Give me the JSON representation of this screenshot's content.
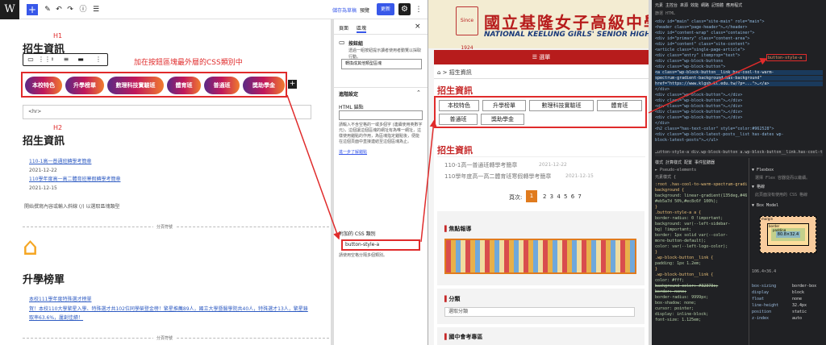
{
  "editor": {
    "logo": "W",
    "toolbar": {
      "add": "+",
      "pen": "✎",
      "undo": "↶",
      "redo": "↷",
      "info": "ⓘ",
      "list": "☰"
    },
    "save_draft": "儲存為草稿",
    "preview": "預覽",
    "update": "更新",
    "settings": "⚙",
    "more": "⋮",
    "annotation_h1": "H1",
    "annotation_h2": "H2",
    "annotation_note": "加在按鈕區塊最外層的CSS類別中",
    "title": "招生資訊",
    "buttons": [
      "本校特色",
      "升學榜單",
      "數理科技實驗班",
      "體育班",
      "普通班",
      "獎助學金"
    ],
    "hr_tag": "<hr>",
    "h2_title": "招生資訊",
    "posts": [
      {
        "title": "110-1高一普通班轉學考簡章",
        "date": "2021-12-22"
      },
      {
        "title": "110學年度高一高二體育班寒假轉學考簡章",
        "date": "2021-12-15"
      }
    ],
    "placeholder": "開始撰寫內容或輸入斜線 (/) 以選取區塊類型",
    "separator": "分頁符號",
    "house_icon": "⌂",
    "section2_title": "升學榜單",
    "section2_link": "本校111學年度特殊選才榜單",
    "section2_text": "賀！本校110大學繁星入學、特殊選才共102位同學榮登金榜！繁星推薦89人，國立大學暨醫學院共40人，特殊選才13人，繁星錄取率63.6%，屢創佳績！",
    "sidebar": {
      "tab_page": "頁面",
      "tab_block": "區塊",
      "close": "×",
      "block_name": "按鈕組",
      "block_desc": "透過一組按鈕提示讀者使用者動覽以採取行動。",
      "transform": "轉換成其他類型區塊",
      "advanced": "進階設定",
      "html_anchor": "HTML 錨點",
      "anchor_desc": "請輸入不含空格的一或多個字 (連續使用英數字元)，這個讓這個區塊的網址有為唯一網址，這樣使用錨點的作用，為區塊指定錨點後，便能在這個頁面中直接連結至這個區塊為止。",
      "anchor_link": "進一步了解錨點",
      "css_label": "附加的 CSS 類別",
      "css_value": "button-style-a",
      "css_desc": "請使用空格分隔多個類別。"
    }
  },
  "site": {
    "school_zh": "國立基隆女子高級中學",
    "school_en": "NATIONAL KEELUNG GIRLS' SENIOR HIGH SCHOOL",
    "since": "Since 1924",
    "menu": "☰ 選單",
    "breadcrumb": "⌂ > 招生資訊",
    "title": "招生資訊",
    "buttons": [
      "本校特色",
      "升學榜單",
      "數理科技實驗班",
      "體育班",
      "普通班",
      "獎助學金"
    ],
    "section_title": "招生資訊",
    "posts": [
      {
        "title": "110-1高一普通班轉學考簡章",
        "date": "2021-12-22"
      },
      {
        "title": "110學年度高一高二體育班寒假轉學考簡章",
        "date": "2021-12-15"
      }
    ],
    "page_label": "頁次:",
    "page_current": "1",
    "page_rest": "2 3 4 5 6 7",
    "focus": "焦點報導",
    "category": "分類",
    "category_select": "選取分類",
    "junior": "國中會考專區"
  },
  "devtools": {
    "tabs": "元素  主控台  來源  效能  網路  記憶體  應用程式",
    "filter": "篩選 HTML",
    "lines": [
      "<div id=\"main\" class=\"site-main\" role=\"main\">",
      " <header class=\"page-header\">…</header>",
      " <div id=\"content-wrap\" class=\"container\">",
      "  <div id=\"primary\" class=\"content-area\">",
      "   <div id=\"content\" class=\"site-content\">",
      "    <article class=\"single-page-article\">",
      "     <div class=\"entry\" itemprop=\"text\">",
      "      <div class=\"wp-block-buttons",
      "       <div class=\"wp-block-button\">",
      "        <a class=\"wp-block-button__link has-cool-to-warm-",
      "        spectrum-gradient-background has-background\"",
      "        href=\"https://www.klgsh.kl.edu.tw/?p=...\">…</a>",
      "       </div>",
      "       <div class=\"wp-block-button\">…</div>",
      "       <div class=\"wp-block-button\">…</div>",
      "       <div class=\"wp-block-button\">…</div>",
      "       <div class=\"wp-block-button\">…</div>",
      "       <div class=\"wp-block-button\">…</div>",
      "      </div>",
      "      <h2 class=\"has-text-color\" style=\"color:#962528\">",
      "      <div class=\"wp-block-latest-posts__list has-dates wp-",
      "      block-latest-posts\">…</ul>"
    ],
    "css_class_box": "button-style-a",
    "breadcrumb": "…utton-style-a  div.wp-block-button  a.wp-block-button__link.has-cool-to-warm…",
    "styles_tabs": "樣式  計算樣式  配置  事件監聽器",
    "pseudo": "► Pseudo-elements",
    "element": "元素樣式 {",
    "rules": [
      ":root .has-cool-to-warm-spectrum-gradient-",
      "background {",
      "  background: linear-gradient(135deg,#4654b9 0%,",
      "  #eb5a7d 50%,#ec8c6f 100%);",
      "}",
      ".button-style-a a {",
      "  border-radius: 0 !important;",
      "  background: var(--left-sidebar-",
      "  bg) !important;",
      "  border: 1px solid var(--color-",
      "  more-button-default);",
      "  color: var(--left-logo-color);",
      "}",
      ".wp-block-button__link {",
      "  padding: 1px 1.2em;",
      "}",
      ".wp-block-button__link {",
      "  color: #fff;",
      "  background-color: #32373c;",
      "  border: none;",
      "  border-radius: 9999px;",
      "  box-shadow: none;",
      "  cursor: pointer;",
      "  display: inline-block;",
      "  font-size: 1.125em;"
    ],
    "right_panel": {
      "flexbox": "▼ Flexbox",
      "flex_note": "選擇 Flex 容器從而以繼續。",
      "grid": "▼ 格線",
      "grid_note": "此頁面沒有使用的 CSS 格線",
      "box_model": "▼ Box Model",
      "margin": "margin",
      "border": "border",
      "padding": "padding",
      "content": "80.8×32.4",
      "size": "106.4×36.4",
      "props": [
        [
          "box-sizing",
          "border-box"
        ],
        [
          "display",
          "block"
        ],
        [
          "float",
          "none"
        ],
        [
          "line-height",
          "32.4px"
        ],
        [
          "position",
          "static"
        ],
        [
          "z-index",
          "auto"
        ]
      ]
    }
  }
}
